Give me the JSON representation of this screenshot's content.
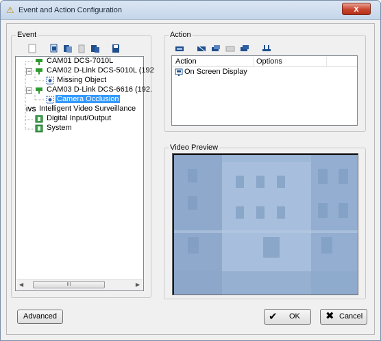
{
  "window": {
    "title": "Event and Action Configuration",
    "close_glyph": "x"
  },
  "event_group": {
    "label": "Event",
    "toolbar_icons": [
      "new-icon",
      "copy-icon",
      "paste-icon",
      "delete-icon",
      "move-icon",
      "save-icon"
    ],
    "tree": [
      {
        "label": "CAM01 DCS-7010L",
        "icon": "camera-icon",
        "level": 0,
        "expander": ""
      },
      {
        "label": "CAM02 D-Link DCS-5010L (192",
        "icon": "camera-icon",
        "level": 0,
        "expander": "−"
      },
      {
        "label": "Missing Object",
        "icon": "event-icon",
        "level": 1,
        "expander": ""
      },
      {
        "label": "CAM03 D-Link DCS-6616 (192.",
        "icon": "camera-icon",
        "level": 0,
        "expander": "−"
      },
      {
        "label": "Camera Occlusion",
        "icon": "event-icon",
        "level": 1,
        "expander": "",
        "selected": true
      },
      {
        "label": "Intelligent Video Surveillance",
        "icon": "ivs-icon",
        "level": 0,
        "expander": ""
      },
      {
        "label": "Digital Input/Output",
        "icon": "io-icon",
        "level": 0,
        "expander": ""
      },
      {
        "label": "System",
        "icon": "system-icon",
        "level": 0,
        "expander": ""
      }
    ],
    "scroll_thumb_grip": "III"
  },
  "action_group": {
    "label": "Action",
    "toolbar_icons": [
      "add-action-icon",
      "edit-action-icon",
      "copy-action-icon",
      "delete-action-icon",
      "paste-action-icon",
      "test-action-icon"
    ],
    "columns": [
      "Action",
      "Options"
    ],
    "rows": [
      {
        "action": "On Screen Display",
        "options": ""
      }
    ]
  },
  "preview_group": {
    "label": "Video Preview"
  },
  "buttons": {
    "advanced": "Advanced",
    "ok": "OK",
    "cancel": "Cancel"
  },
  "colors": {
    "selection": "#3399ff",
    "tint": "#9bb6d6"
  }
}
